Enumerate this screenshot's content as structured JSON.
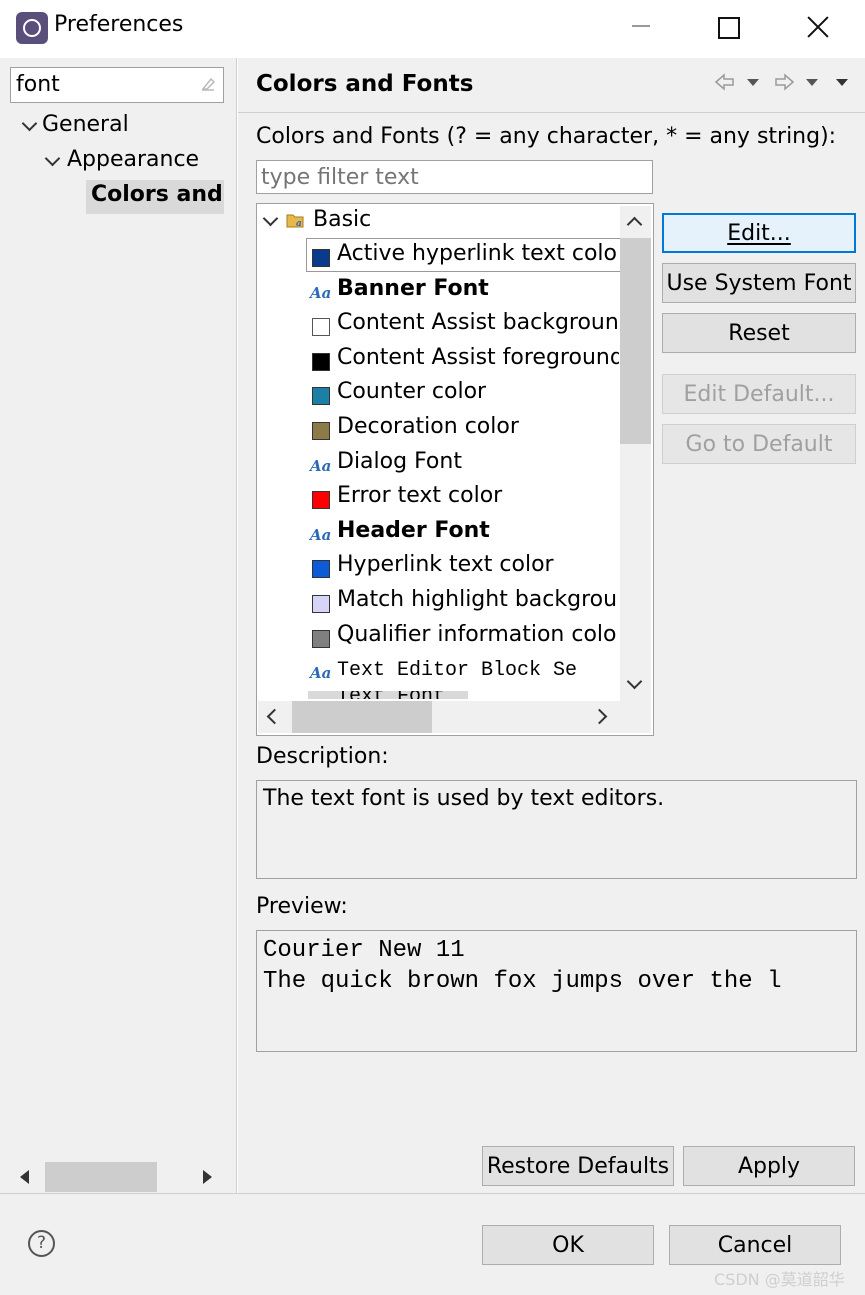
{
  "window": {
    "title": "Preferences",
    "icon": "eclipse-preferences-icon"
  },
  "search": {
    "value": "font"
  },
  "nav_tree": {
    "items": [
      {
        "label": "General",
        "expanded": true
      },
      {
        "label": "Appearance",
        "expanded": true
      },
      {
        "label": "Colors and Fonts",
        "shown_text": "Colors and",
        "selected": true
      }
    ]
  },
  "page": {
    "title": "Colors and Fonts",
    "list_label": "Colors and Fonts (? = any character, * = any string):",
    "filter_placeholder": "type filter text"
  },
  "font_tree": {
    "group": "Basic",
    "items": [
      {
        "label": "Active hyperlink text color",
        "kind": "color",
        "swatch": "#0a3a8c",
        "bold": false,
        "selected": true
      },
      {
        "label": "Banner Font",
        "kind": "font",
        "bold": true
      },
      {
        "label": "Content Assist backgroun",
        "kind": "color",
        "swatch": "#ffffff",
        "bold": false
      },
      {
        "label": "Content Assist foreground",
        "kind": "color",
        "swatch": "#000000",
        "bold": false
      },
      {
        "label": "Counter color",
        "kind": "color",
        "swatch": "#1b7fa6",
        "bold": false
      },
      {
        "label": "Decoration color",
        "kind": "color",
        "swatch": "#8e7a46",
        "bold": false
      },
      {
        "label": "Dialog Font",
        "kind": "font",
        "bold": false
      },
      {
        "label": "Error text color",
        "kind": "color",
        "swatch": "#ff0000",
        "bold": false
      },
      {
        "label": "Header Font",
        "kind": "font",
        "bold": true
      },
      {
        "label": "Hyperlink text color",
        "kind": "color",
        "swatch": "#0b5cd6",
        "bold": false
      },
      {
        "label": "Match highlight backgrou",
        "kind": "color",
        "swatch": "#d6d4f7",
        "bold": false
      },
      {
        "label": "Qualifier information colo",
        "kind": "color",
        "swatch": "#808080",
        "bold": false
      },
      {
        "label": "Text Editor Block Se",
        "kind": "font",
        "bold": false,
        "mono": true
      },
      {
        "label": "Text Font",
        "kind": "font",
        "bold": false,
        "mono": true,
        "partially_visible": true
      }
    ]
  },
  "buttons": {
    "edit": "Edit...",
    "use_system_font": "Use System Font",
    "reset": "Reset",
    "edit_default": "Edit Default...",
    "go_to_default": "Go to Default",
    "restore_defaults": "Restore Defaults",
    "apply": "Apply",
    "ok": "OK",
    "cancel": "Cancel"
  },
  "description": {
    "label": "Description:",
    "text": "The text font is used by text editors."
  },
  "preview": {
    "label": "Preview:",
    "line1": "Courier New 11",
    "line2": "The quick brown fox jumps over the l"
  },
  "watermark": "CSDN @莫道韶华",
  "colors": {
    "focus_border": "#0078d7",
    "panel_bg": "#f0f0f0",
    "selection_bg": "#d9d9d9"
  }
}
